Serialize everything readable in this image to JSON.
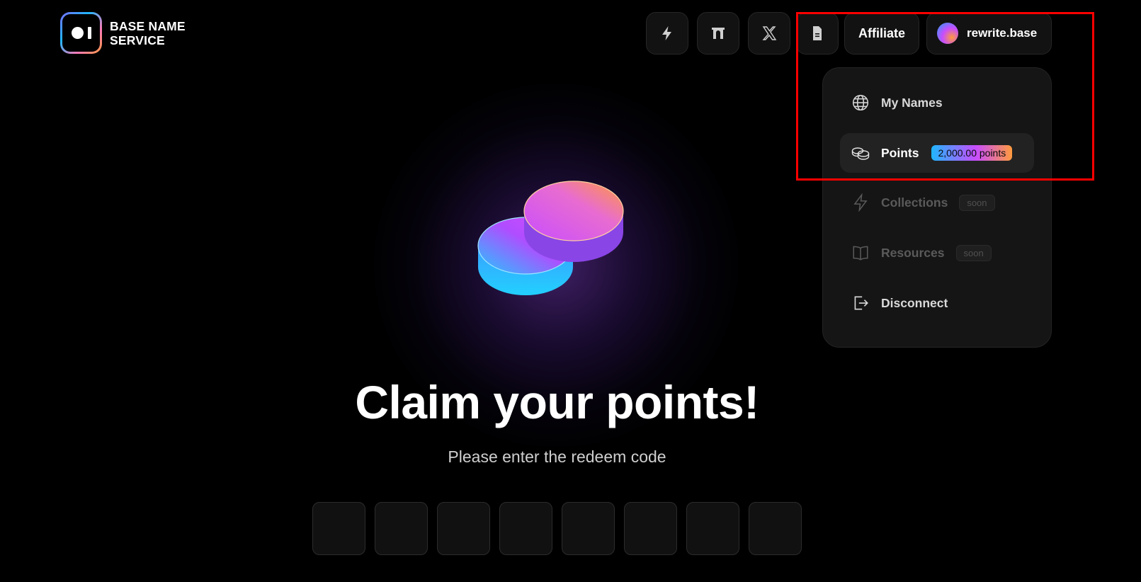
{
  "brand": {
    "line1": "BASE NAME",
    "line2": "SERVICE"
  },
  "header": {
    "icon_buttons": [
      "lightning-icon",
      "gateway-icon",
      "x-logo-icon",
      "document-icon"
    ],
    "affiliate_label": "Affiliate",
    "account_label": "rewrite.base"
  },
  "menu": {
    "my_names": "My Names",
    "points": "Points",
    "points_badge": "2,000.00 points",
    "collections": "Collections",
    "collections_badge": "soon",
    "resources": "Resources",
    "resources_badge": "soon",
    "disconnect": "Disconnect"
  },
  "hero": {
    "title": "Claim your points!",
    "subtitle": "Please enter the redeem code",
    "code_length": 8
  },
  "colors": {
    "accent_cyan": "#1fb6ff",
    "accent_purple": "#c84dff",
    "accent_orange": "#ff9a3d",
    "highlight": "#ff0000"
  }
}
